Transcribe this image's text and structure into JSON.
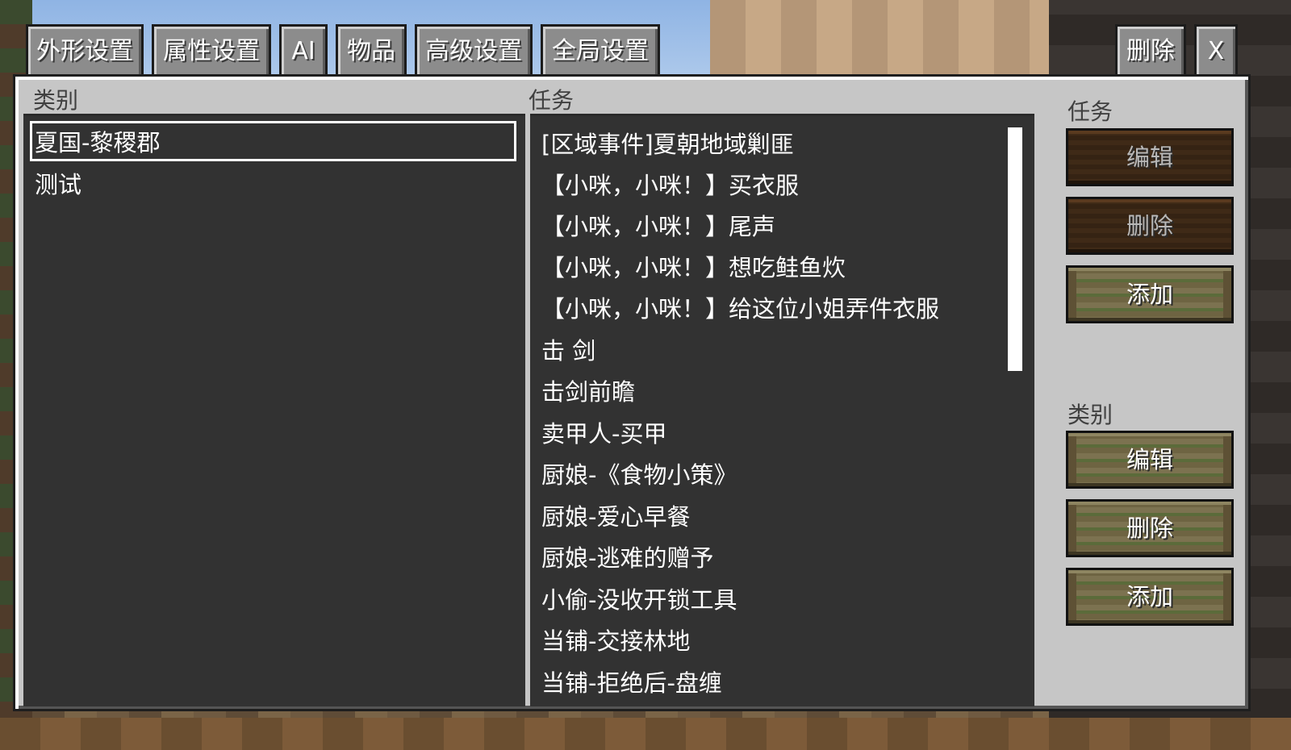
{
  "hud": {
    "top_left_text": ""
  },
  "tabs": [
    {
      "label": "外形设置"
    },
    {
      "label": "属性设置"
    },
    {
      "label": "AI"
    },
    {
      "label": "物品"
    },
    {
      "label": "高级设置"
    },
    {
      "label": "全局设置"
    }
  ],
  "top_right": {
    "delete_label": "删除",
    "close_label": "X"
  },
  "category_panel": {
    "header": "类别",
    "items": [
      {
        "label": "夏国-黎稷郡",
        "selected": true
      },
      {
        "label": "测试",
        "selected": false
      }
    ]
  },
  "quest_panel": {
    "header": "任务",
    "items": [
      "[区域事件]夏朝地域剿匪",
      "【小咪，小咪！】买衣服",
      "【小咪，小咪！】尾声",
      "【小咪，小咪！】想吃鲑鱼炊",
      "【小咪，小咪！】给这位小姐弄件衣服",
      "击 剑",
      "击剑前瞻",
      "卖甲人-买甲",
      "厨娘-《食物小策》",
      "厨娘-爱心早餐",
      "厨娘-逃难的赠予",
      "小偷-没收开锁工具",
      "当铺-交接林地",
      "当铺-拒绝后-盘缠"
    ]
  },
  "side": {
    "quest_header": "任务",
    "quest_buttons": [
      {
        "label": "编辑",
        "enabled": false
      },
      {
        "label": "删除",
        "enabled": false
      },
      {
        "label": "添加",
        "enabled": true
      }
    ],
    "category_header": "类别",
    "category_buttons": [
      {
        "label": "编辑",
        "enabled": true
      },
      {
        "label": "删除",
        "enabled": true
      },
      {
        "label": "添加",
        "enabled": true
      }
    ]
  },
  "colors": {
    "panel": "#c6c6c6",
    "list_bg": "#323232",
    "tab_bg": "#8c8c8c"
  }
}
